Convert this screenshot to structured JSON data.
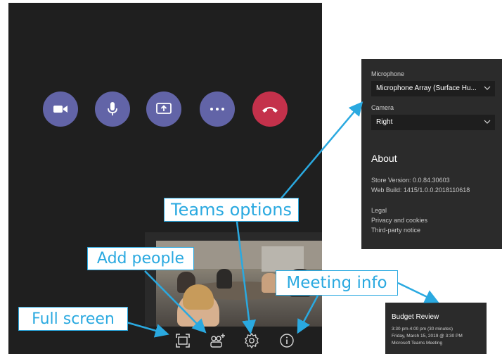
{
  "callouts": {
    "teams_options": "Teams options",
    "add_people": "Add people",
    "meeting_info": "Meeting info",
    "full_screen": "Full screen"
  },
  "call_controls": [
    {
      "name": "camera",
      "icon": "video-camera-icon",
      "color": "#6264a7"
    },
    {
      "name": "microphone",
      "icon": "microphone-icon",
      "color": "#6264a7"
    },
    {
      "name": "share",
      "icon": "share-screen-icon",
      "color": "#6264a7"
    },
    {
      "name": "more",
      "icon": "more-options-icon",
      "color": "#6264a7"
    },
    {
      "name": "hang-up",
      "icon": "hang-up-icon",
      "color": "#c4314b"
    }
  ],
  "bottom_bar": [
    {
      "icon": "full-screen-icon"
    },
    {
      "icon": "add-people-icon"
    },
    {
      "icon": "settings-gear-icon"
    },
    {
      "icon": "info-icon"
    }
  ],
  "options_panel": {
    "microphone_label": "Microphone",
    "microphone_value": "Microphone Array (Surface Hu...",
    "camera_label": "Camera",
    "camera_value": "Right",
    "about_heading": "About",
    "store_version": "Store Version: 0.0.84.30603",
    "web_build": "Web Build: 1415/1.0.0.2018110618",
    "legal": "Legal",
    "privacy": "Privacy and cookies",
    "third_party": "Third-party notice"
  },
  "meeting_info": {
    "title": "Budget Review",
    "time": "3:30 pm-4:00 pm (30 minutes)",
    "date": "Friday, March 15, 2019 @ 3:30 PM",
    "type": "Microsoft Teams Meeting"
  },
  "colors": {
    "accent": "#6264a7",
    "hang_up": "#c4314b",
    "callout": "#2aa9e0",
    "stage": "#1f1f1f",
    "panel": "#2b2b2b"
  }
}
